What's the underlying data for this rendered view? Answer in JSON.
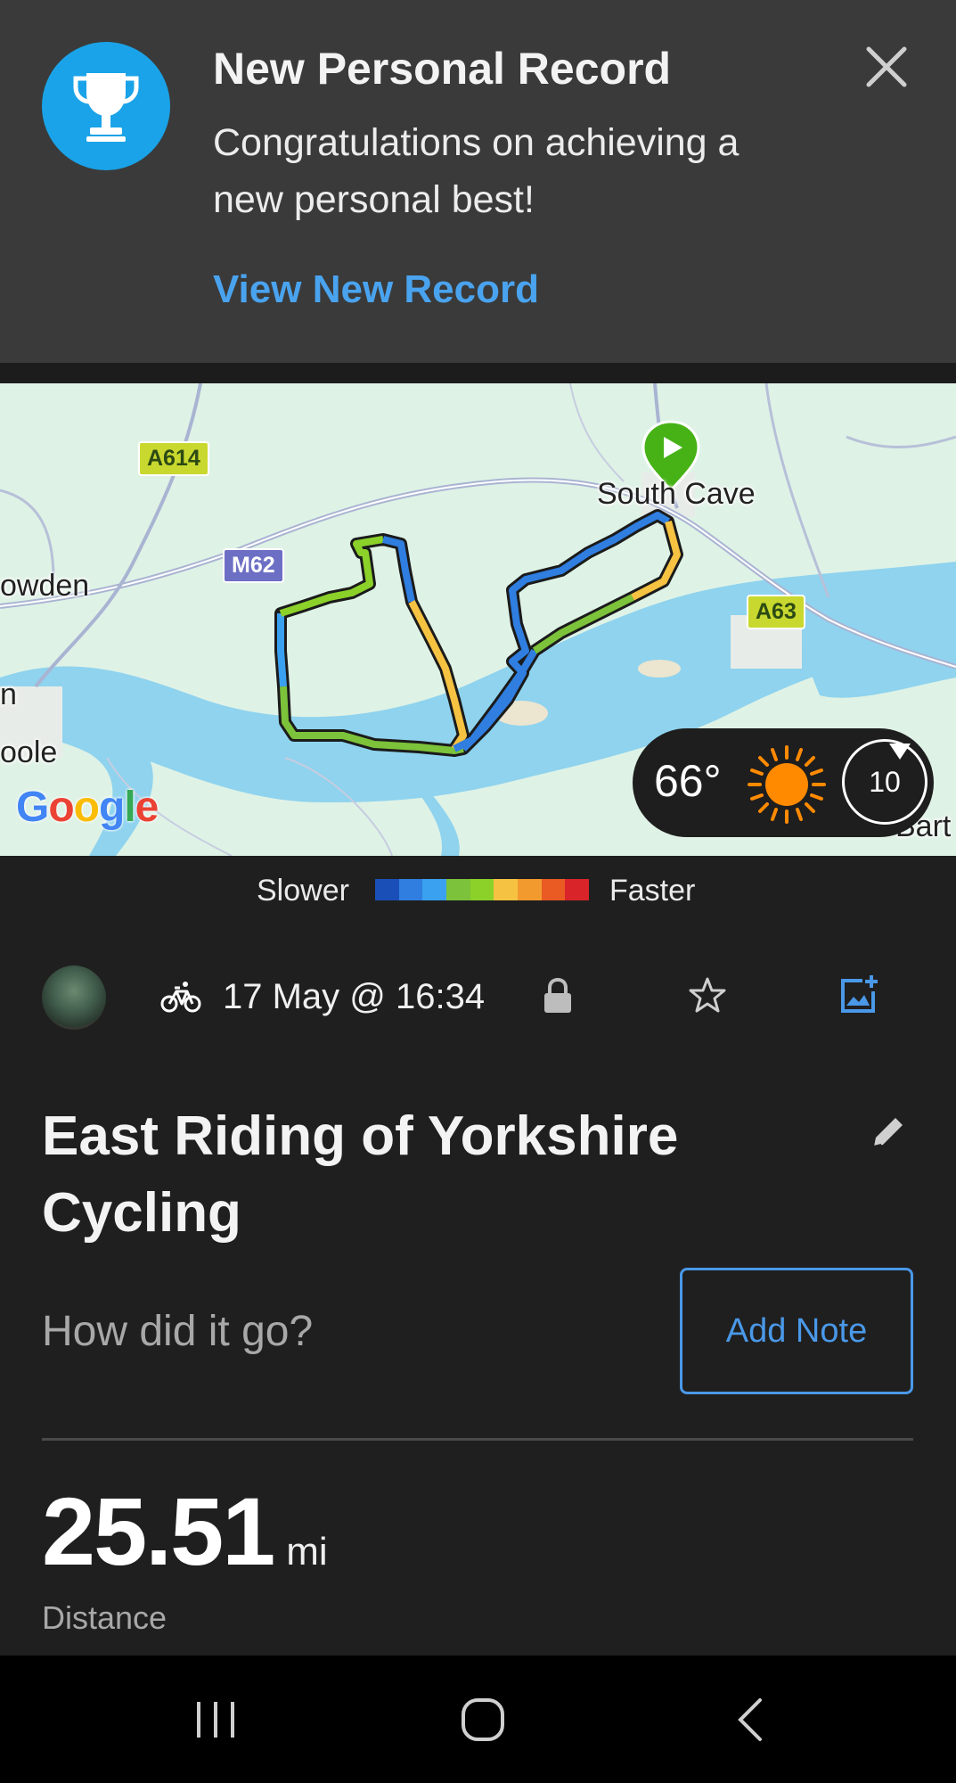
{
  "notification": {
    "title": "New Personal Record",
    "body": "Congratulations on achieving a new personal best!",
    "link": "View New Record",
    "icon": "trophy-icon",
    "accent": "#1aa3e8"
  },
  "map": {
    "road_labels": [
      "A614",
      "M62",
      "A63"
    ],
    "place_labels": [
      "South Cave",
      "owden",
      "oole",
      "Bart",
      "n"
    ],
    "attribution": "Google",
    "weather": {
      "temperature": "66°",
      "wind": "10",
      "icon": "sun-icon"
    }
  },
  "speed_legend": {
    "slower": "Slower",
    "faster": "Faster",
    "colors": [
      "#1a4fb8",
      "#2f7ee0",
      "#3aa0f0",
      "#7cc23a",
      "#8bd12a",
      "#f5c242",
      "#f29a2e",
      "#ea5a23",
      "#d9242a"
    ]
  },
  "activity": {
    "type_icon": "bicycle-icon",
    "date": "17 May @ 16:34",
    "title": "East Riding of Yorkshire Cycling",
    "prompt": "How did it go?",
    "add_note": "Add Note",
    "distance_value": "25.51",
    "distance_unit": "mi",
    "distance_label": "Distance"
  },
  "colors": {
    "link": "#4a98e8",
    "background": "#1f1f1f",
    "notification_bg": "#3a3a3a"
  }
}
